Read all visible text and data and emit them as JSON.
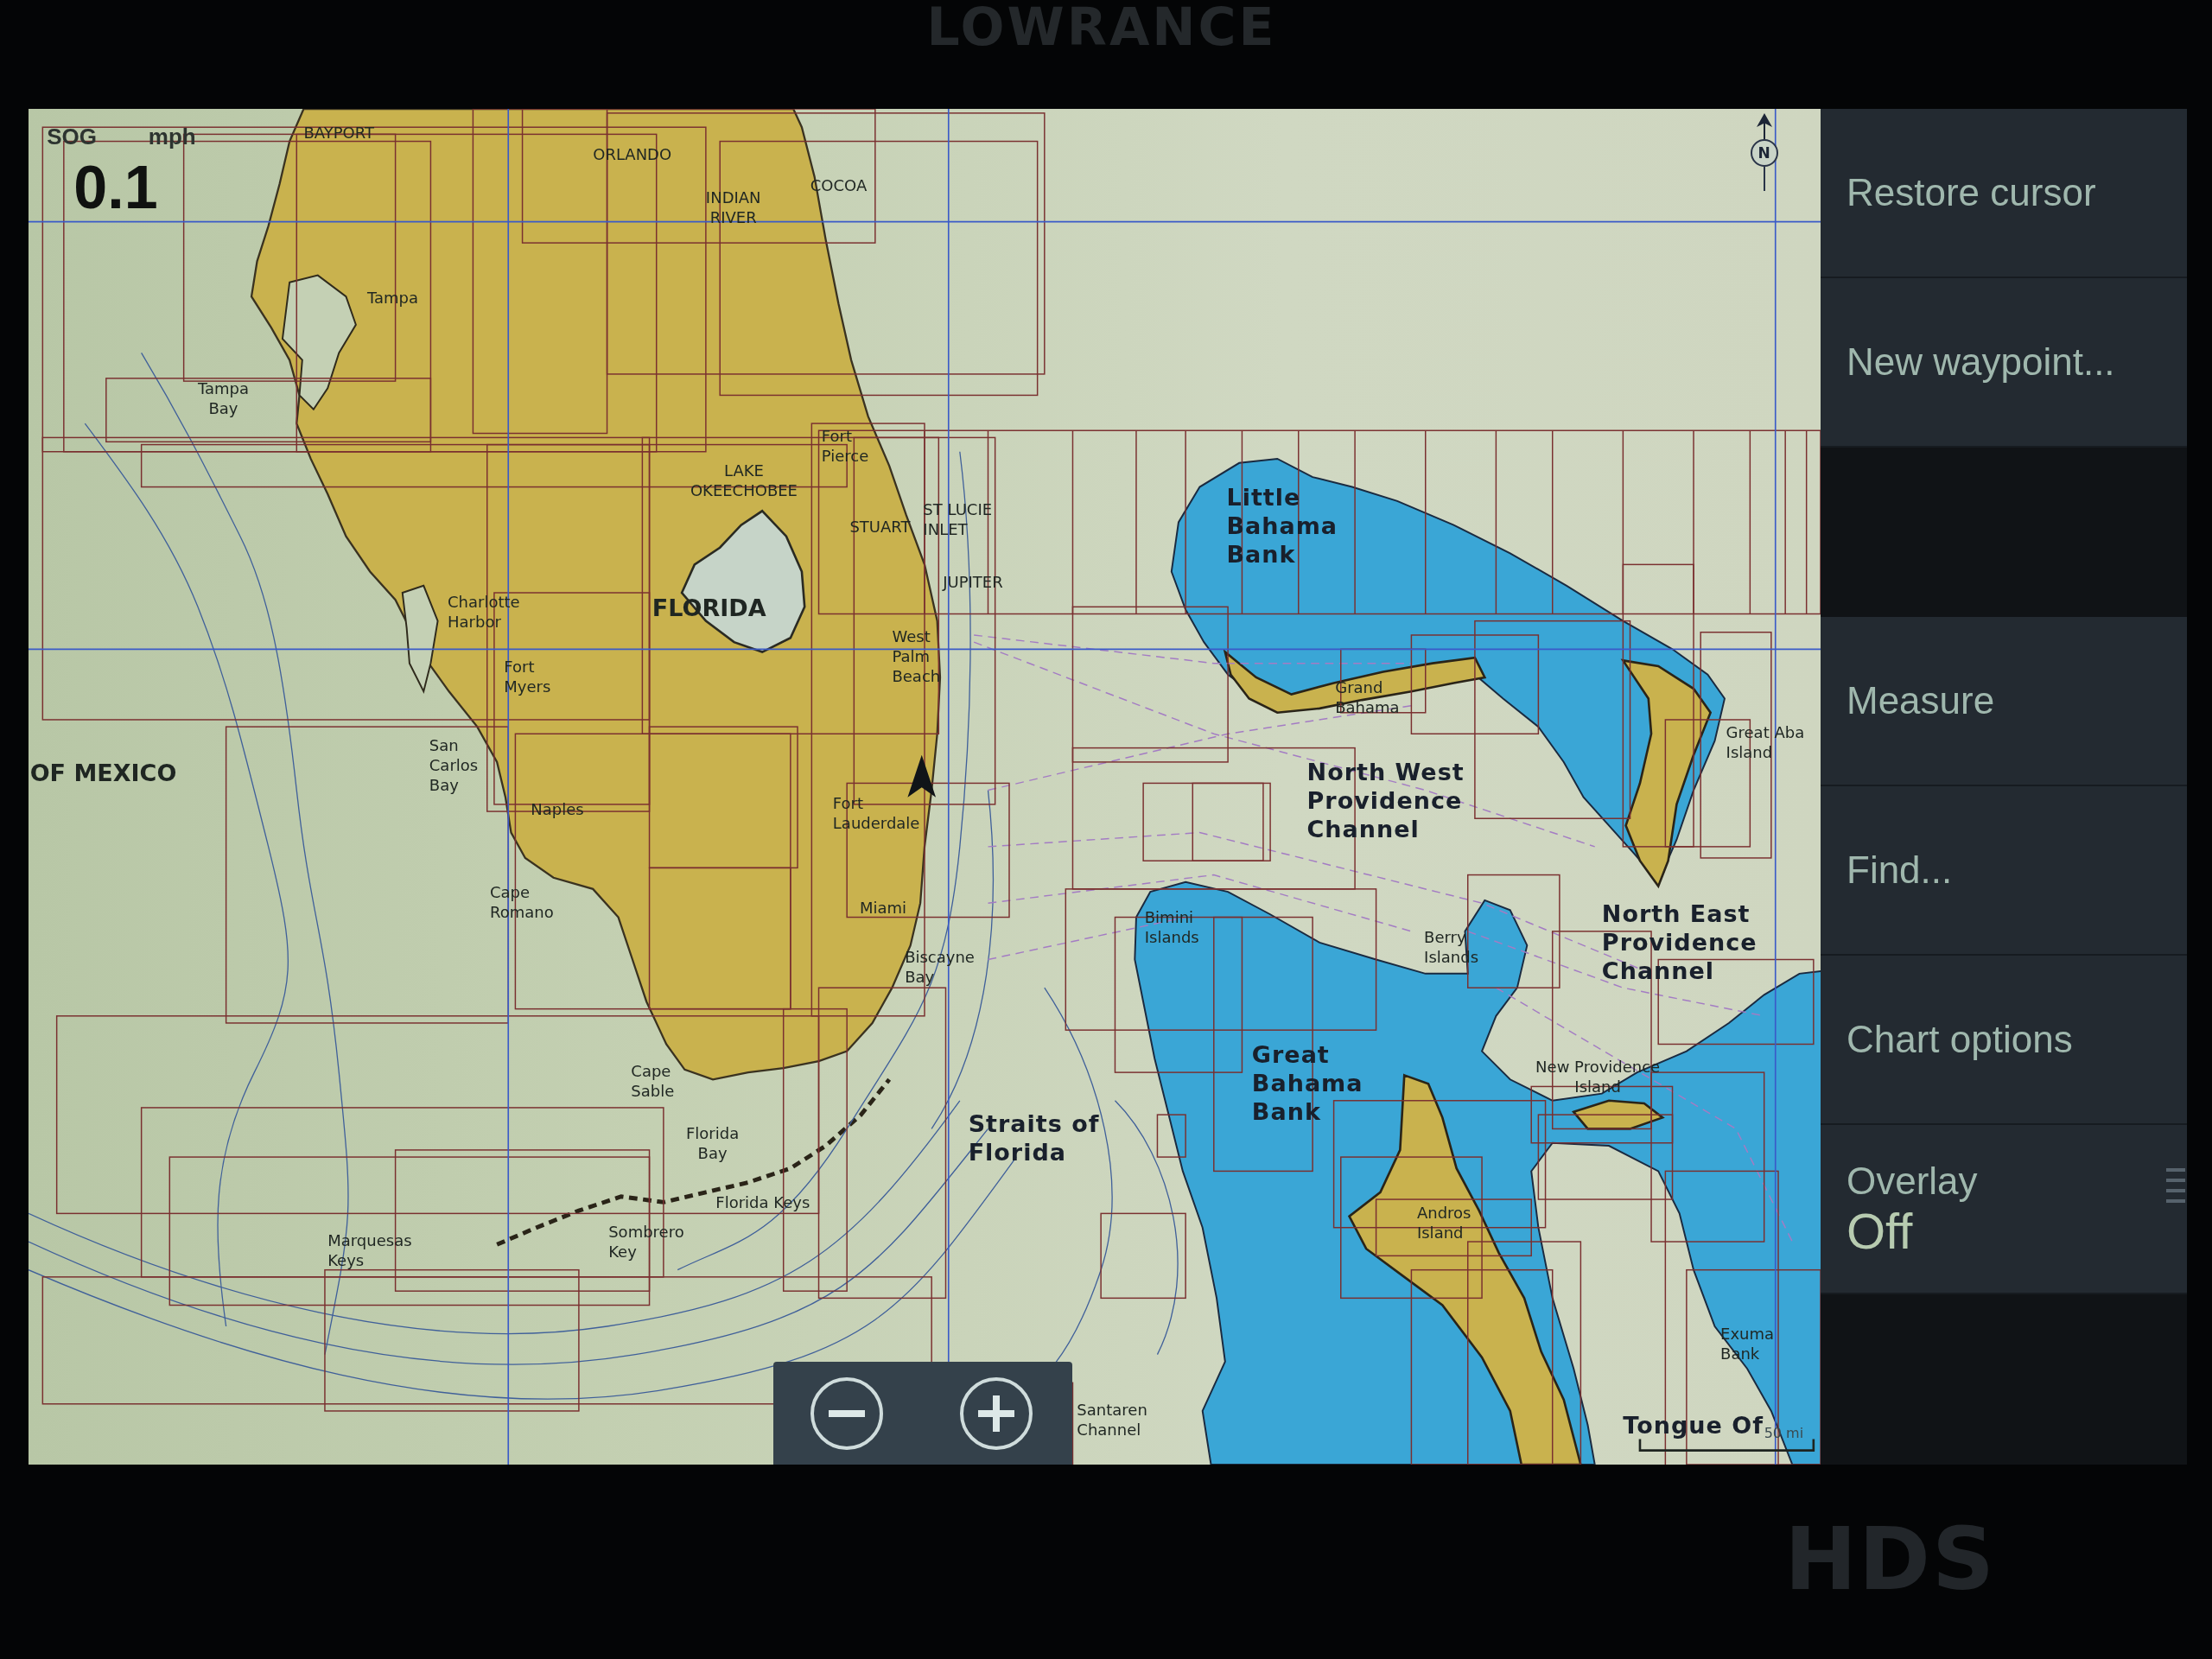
{
  "bezel": {
    "brand": "LOWRANCE",
    "model": "HDS"
  },
  "chart": {
    "speed": {
      "label": "SOG",
      "unit": "mph",
      "value": "0.1"
    },
    "north_indicator": {
      "label": "N"
    },
    "labels": [
      {
        "text": "BAYPORT",
        "kind": "place"
      },
      {
        "text": "ORLANDO",
        "kind": "place"
      },
      {
        "text": "INDIAN\nRIVER",
        "kind": "place"
      },
      {
        "text": "COCOA",
        "kind": "place"
      },
      {
        "text": "Tampa",
        "kind": "place"
      },
      {
        "text": "Tampa\nBay",
        "kind": "place"
      },
      {
        "text": "LAKE\nOKEECHOBEE",
        "kind": "place"
      },
      {
        "text": "Fort\nPierce",
        "kind": "place"
      },
      {
        "text": "STUART",
        "kind": "place"
      },
      {
        "text": "ST LUCIE\nINLET",
        "kind": "place"
      },
      {
        "text": "JUPITER",
        "kind": "place"
      },
      {
        "text": "FLORIDA",
        "kind": "region"
      },
      {
        "text": "Charlotte\nHarbor",
        "kind": "place"
      },
      {
        "text": "Fort\nMyers",
        "kind": "place"
      },
      {
        "text": "West\nPalm\nBeach",
        "kind": "place"
      },
      {
        "text": "OF MEXICO",
        "kind": "region"
      },
      {
        "text": "San\nCarlos\nBay",
        "kind": "place"
      },
      {
        "text": "Naples",
        "kind": "place"
      },
      {
        "text": "Fort\nLauderdale",
        "kind": "place"
      },
      {
        "text": "Cape\nRomano",
        "kind": "place"
      },
      {
        "text": "Miami",
        "kind": "place"
      },
      {
        "text": "Biscayne\nBay",
        "kind": "place"
      },
      {
        "text": "Cape\nSable",
        "kind": "place"
      },
      {
        "text": "Florida\nBay",
        "kind": "place"
      },
      {
        "text": "Florida Keys",
        "kind": "place"
      },
      {
        "text": "Marquesas\nKeys",
        "kind": "place"
      },
      {
        "text": "Sombrero\nKey",
        "kind": "place"
      },
      {
        "text": "Straits of\nFlorida",
        "kind": "water"
      },
      {
        "text": "Little\nBahama\nBank",
        "kind": "water"
      },
      {
        "text": "Grand\nBahama",
        "kind": "place"
      },
      {
        "text": "North West\nProvidence\nChannel",
        "kind": "water"
      },
      {
        "text": "Great Aba\nIsland",
        "kind": "place"
      },
      {
        "text": "Bimini\nIslands",
        "kind": "place"
      },
      {
        "text": "Berry\nIslands",
        "kind": "place"
      },
      {
        "text": "North East\nProvidence\nChannel",
        "kind": "water"
      },
      {
        "text": "Great\nBahama\nBank",
        "kind": "water"
      },
      {
        "text": "New Providence\nIsland",
        "kind": "place"
      },
      {
        "text": "Andros\nIsland",
        "kind": "place"
      },
      {
        "text": "Exuma\nBank",
        "kind": "place"
      },
      {
        "text": "Santaren\nChannel",
        "kind": "place"
      },
      {
        "text": "Tongue Of",
        "kind": "water"
      }
    ],
    "scale_bar": {
      "label": "50 mi"
    }
  },
  "side_menu": {
    "items": [
      {
        "kind": "action",
        "label": "Restore cursor"
      },
      {
        "kind": "action",
        "label": "New waypoint..."
      },
      {
        "kind": "gap"
      },
      {
        "kind": "action",
        "label": "Measure"
      },
      {
        "kind": "action",
        "label": "Find..."
      },
      {
        "kind": "action",
        "label": "Chart options"
      },
      {
        "kind": "setting",
        "label": "Overlay",
        "value": "Off"
      },
      {
        "kind": "gap"
      }
    ]
  }
}
